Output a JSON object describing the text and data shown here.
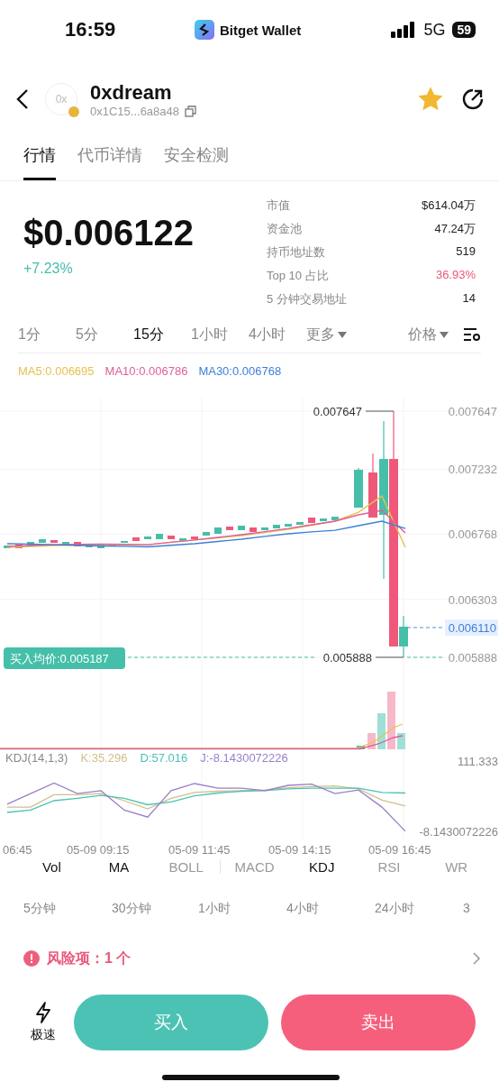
{
  "status_bar": {
    "time": "16:59",
    "app_name": "Bitget Wallet",
    "network": "5G",
    "battery": "59"
  },
  "token": {
    "logo_text": "0x",
    "name": "0xdream",
    "address": "0x1C15...6a8a48",
    "favorited": true
  },
  "tabs": [
    {
      "label": "行情",
      "selected": true
    },
    {
      "label": "代币详情",
      "selected": false
    },
    {
      "label": "安全检测",
      "selected": false
    }
  ],
  "price": {
    "value": "$0.006122",
    "change": "+7.23%"
  },
  "stats": [
    {
      "label": "市值",
      "value": "$614.04万",
      "kind": "plain"
    },
    {
      "label": "资金池",
      "value": "47.24万",
      "kind": "plain"
    },
    {
      "label": "持币地址数",
      "value": "519",
      "kind": "plain"
    },
    {
      "label": "Top 10 占比",
      "value": "36.93%",
      "kind": "warning"
    },
    {
      "label": "5 分钟交易地址",
      "value": "14",
      "kind": "plain"
    }
  ],
  "intervals": [
    {
      "label": "1分",
      "selected": false
    },
    {
      "label": "5分",
      "selected": false
    },
    {
      "label": "15分",
      "selected": true
    },
    {
      "label": "1小时",
      "selected": false
    },
    {
      "label": "4小时",
      "selected": false
    }
  ],
  "more_menu": {
    "label": "更多"
  },
  "price_type_menu": {
    "label": "价格"
  },
  "chart": {
    "ma_legend": [
      ":0.006695",
      ":0.006786",
      ":0.006768"
    ],
    "chart_data": {
      "type": "line",
      "ylim": [
        0.005888,
        0.007647
      ],
      "yticks": [
        {
          "value": 0.007647,
          "label": "0.007647"
        },
        {
          "value": 0.007232,
          "label": "0.007232"
        },
        {
          "value": 0.006768,
          "label": "0.006768"
        },
        {
          "value": 0.006303,
          "label": "0.006303"
        },
        {
          "value": 0.005888,
          "label": "0.005888"
        }
      ],
      "categories": [
        null,
        null,
        null,
        null,
        null,
        null,
        null,
        null,
        null,
        null,
        null,
        null,
        null,
        null,
        null,
        null,
        null,
        null
      ],
      "series": [
        {
          "name": "MA5",
          "color": "#e6c14f",
          "values": [
            0.006674,
            0.00668,
            0.006687,
            0.00669,
            0.006693,
            0.006693,
            0.006693,
            0.00671,
            0.006726,
            0.006742,
            0.006758,
            0.00678,
            0.006803,
            0.006832,
            0.006861,
            0.006925,
            0.007041,
            0.006674
          ]
        },
        {
          "name": "MA10",
          "color": "#de5f98",
          "values": [
            0.006681,
            0.006687,
            0.006693,
            0.006695,
            0.006697,
            0.006695,
            0.006693,
            0.00671,
            0.006726,
            0.006745,
            0.006764,
            0.006786,
            0.006809,
            0.006835,
            0.006861,
            0.006906,
            0.006938,
            0.006777
          ]
        },
        {
          "name": "MA30",
          "color": "#3d7fd8",
          "values": [
            0.0067,
            0.006697,
            0.006693,
            0.006689,
            0.006684,
            0.006681,
            0.006677,
            0.006689,
            0.0067,
            0.006716,
            0.006732,
            0.006752,
            0.006771,
            0.006784,
            0.006796,
            0.006829,
            0.006861,
            0.006809
          ]
        }
      ]
    },
    "current_price": "0.006110",
    "high_label": "0.007647",
    "low_label": "0.005888",
    "buy_average": "买入均价:0.005187",
    "kdj": {
      "title": "KDJ(14,1,3)",
      "legend": [
        ":35.296",
        ":57.016",
        ":-8.1430072226"
      ],
      "chart_data": {
        "type": "line",
        "ylim": [
          -8.1430072226,
          111.333
        ],
        "yticks": [
          {
            "value": 111.333,
            "label": "111.333"
          },
          {
            "value": -8.1430072226,
            "label": "-8.1430072226"
          }
        ],
        "categories": [
          null,
          null,
          null,
          null,
          null,
          null,
          null,
          null,
          null,
          null,
          null,
          null,
          null,
          null,
          null,
          null,
          null,
          null
        ],
        "series": [
          {
            "name": "K",
            "color": "#cfc08c",
            "values": [
              33,
              33,
              54,
              54,
              56,
              44,
              30,
              48,
              58,
              60,
              61,
              62,
              66,
              68,
              69,
              64,
              45,
              35
            ]
          },
          {
            "name": "D",
            "color": "#4cc2b4",
            "values": [
              24,
              28,
              44,
              48,
              53,
              48,
              37,
              42,
              52,
              57,
              60,
              61,
              64,
              65,
              65,
              65,
              58,
              57
            ]
          },
          {
            "name": "J",
            "color": "#9a7fc8",
            "values": [
              38,
              56,
              74,
              56,
              61,
              28,
              16,
              61,
              73,
              65,
              65,
              61,
              70,
              72,
              56,
              62,
              33,
              -8
            ]
          }
        ]
      }
    },
    "time_axis": [
      "06:45",
      "05-09 09:15",
      "05-09 11:45",
      "05-09 14:15",
      "05-09 16:45"
    ]
  },
  "main_indicators": [
    {
      "label": "Vol",
      "selected": true
    },
    {
      "label": "MA",
      "selected": true
    },
    {
      "label": "BOLL",
      "selected": false
    }
  ],
  "sub_indicators": [
    {
      "label": "MACD",
      "selected": false
    },
    {
      "label": "KDJ",
      "selected": true
    },
    {
      "label": "RSI",
      "selected": false
    },
    {
      "label": "WR",
      "selected": false
    }
  ],
  "period_changes": [
    {
      "label": "5分钟"
    },
    {
      "label": "30分钟"
    },
    {
      "label": "1小时"
    },
    {
      "label": "4小时"
    },
    {
      "label": "24小时"
    },
    {
      "label": "3"
    }
  ],
  "risk": {
    "label": "风险项：1 个"
  },
  "actions": {
    "speed_label": "极速",
    "buy": "买入",
    "sell": "卖出"
  }
}
